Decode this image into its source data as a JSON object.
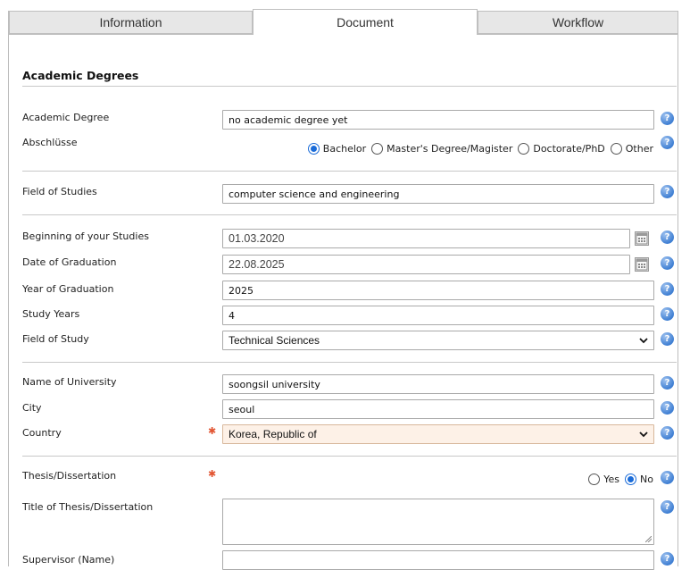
{
  "tabs": [
    {
      "label": "Information",
      "active": false
    },
    {
      "label": "Document",
      "active": true
    },
    {
      "label": "Workflow",
      "active": false
    }
  ],
  "section_title": "Academic Degrees",
  "academic_degree": {
    "label": "Academic Degree",
    "value": "no academic degree yet"
  },
  "abschluesse": {
    "label": "Abschlüsse",
    "options": [
      "Bachelor",
      "Master's Degree/Magister",
      "Doctorate/PhD",
      "Other"
    ],
    "selected": "Bachelor"
  },
  "field_of_studies": {
    "label": "Field of Studies",
    "value": "computer science and engineering"
  },
  "beginning": {
    "label": "Beginning of your Studies",
    "value": "01.03.2020"
  },
  "graduation_date": {
    "label": "Date of Graduation",
    "value": "22.08.2025"
  },
  "graduation_year": {
    "label": "Year of Graduation",
    "value": "2025"
  },
  "study_years": {
    "label": "Study Years",
    "value": "4"
  },
  "field_of_study": {
    "label": "Field of Study",
    "value": "Technical Sciences"
  },
  "university": {
    "label": "Name of University",
    "value": "soongsil university"
  },
  "city": {
    "label": "City",
    "value": "seoul"
  },
  "country": {
    "label": "Country",
    "value": "Korea, Republic of"
  },
  "thesis": {
    "label": "Thesis/Dissertation",
    "options": [
      "Yes",
      "No"
    ],
    "selected": "No"
  },
  "thesis_title": {
    "label": "Title of Thesis/Dissertation",
    "value": ""
  },
  "supervisor": {
    "label": "Supervisor (Name)",
    "value": ""
  },
  "colors": {
    "accent": "#1a6bd8",
    "required": "#e25532",
    "tab_inactive": "#e7e7e7",
    "required_field_bg": "#fdf1e7"
  },
  "icons": {
    "help": "question-circle-icon",
    "calendar": "calendar-icon",
    "required": "asterisk-icon",
    "dropdown": "chevron-down-icon"
  }
}
